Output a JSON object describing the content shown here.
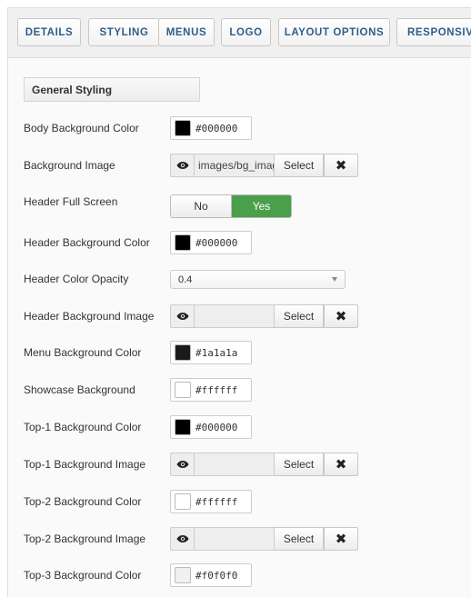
{
  "tabs": [
    {
      "label": "DETAILS"
    },
    {
      "label": "STYLING"
    },
    {
      "label": "MENUS"
    },
    {
      "label": "LOGO"
    },
    {
      "label": "LAYOUT OPTIONS"
    },
    {
      "label": "RESPONSIVE"
    }
  ],
  "section_title": "General Styling",
  "fields": {
    "body_bg_color": {
      "label": "Body Background Color",
      "value": "#000000",
      "swatch": "#000000"
    },
    "bg_image": {
      "label": "Background Image",
      "value": "images/bg_image.jpg",
      "select_label": "Select",
      "clear_label": "✖"
    },
    "header_full_screen": {
      "label": "Header Full Screen",
      "no_label": "No",
      "yes_label": "Yes",
      "selected": "Yes"
    },
    "header_bg_color": {
      "label": "Header Background Color",
      "value": "#000000",
      "swatch": "#000000"
    },
    "header_color_opacity": {
      "label": "Header Color Opacity",
      "value": "0.4"
    },
    "header_bg_image": {
      "label": "Header Background Image",
      "value": "",
      "select_label": "Select",
      "clear_label": "✖"
    },
    "menu_bg_color": {
      "label": "Menu Background Color",
      "value": "#1a1a1a",
      "swatch": "#1a1a1a"
    },
    "showcase_bg": {
      "label": "Showcase Background",
      "value": "#ffffff",
      "swatch": "#ffffff"
    },
    "top1_bg_color": {
      "label": "Top-1 Background Color",
      "value": "#000000",
      "swatch": "#000000"
    },
    "top1_bg_image": {
      "label": "Top-1 Background Image",
      "value": "",
      "select_label": "Select",
      "clear_label": "✖"
    },
    "top2_bg_color": {
      "label": "Top-2 Background Color",
      "value": "#ffffff",
      "swatch": "#ffffff"
    },
    "top2_bg_image": {
      "label": "Top-2 Background Image",
      "value": "",
      "select_label": "Select",
      "clear_label": "✖"
    },
    "top3_bg_color": {
      "label": "Top-3 Background Color",
      "value": "#f0f0f0",
      "swatch": "#f0f0f0"
    }
  },
  "colors": {
    "tab_text": "#2f5d8a",
    "toggle_active": "#4aa04a"
  },
  "icons": {
    "preview": "eye-icon",
    "clear": "close-icon",
    "dropdown": "caret-down-icon"
  }
}
